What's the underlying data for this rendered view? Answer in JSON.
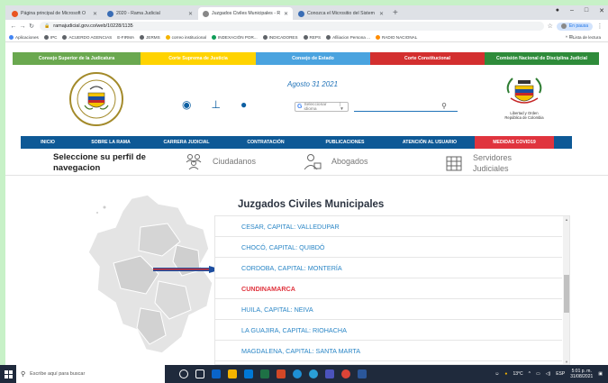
{
  "browser": {
    "tabs": [
      {
        "title": "Página principal de Microsoft O",
        "fav": "#e95420"
      },
      {
        "title": "2020 - Rama Judicial",
        "fav": "#3a6db5"
      },
      {
        "title": "Juzgados Civiles Municipales - R",
        "fav": "#888888"
      },
      {
        "title": "Conozca el Micrositio del Sistem",
        "fav": "#3a6db5"
      }
    ],
    "new_tab": "+",
    "url": "ramajudicial.gov.co/web/10228/1135",
    "profile_label": "En pausa",
    "bookmarks": [
      "Aplicaciones",
      "IPC",
      "ACUERDO AGENCIAS",
      "E-FIRMA",
      "JERMS",
      "correo institucional",
      "INDEXACIÓN POR...",
      "INDICADORES",
      "REPS",
      "Afiliacion Persona ...",
      "RADIO NACIONAL"
    ],
    "reading_list": "Lista de lectura"
  },
  "topnav": [
    {
      "label": "Consejo Superior de la Judicatura",
      "color": "#6aa84f"
    },
    {
      "label": "Corte Suprema de Justicia",
      "color": "#ffd300"
    },
    {
      "label": "Consejo de Estado",
      "color": "#4aa3df"
    },
    {
      "label": "Corte Constitucional",
      "color": "#d32f2f"
    },
    {
      "label": "Comisión Nacional de Disciplina Judicial",
      "color": "#2e8b3a"
    }
  ],
  "header": {
    "date": "Agosto 31 2021",
    "translate_label": "Seleccionar idioma",
    "escudo_line1": "Libertad y Orden",
    "escudo_line2": "República de Colombia"
  },
  "mainnav": [
    "INICIO",
    "SOBRE LA RAMA",
    "CARRERA JUDICIAL",
    "CONTRATACIÓN",
    "PUBLICACIONES",
    "ATENCIÓN AL USUARIO",
    "MEDIDAS COVID19"
  ],
  "profile": {
    "title": "Seleccione su perfil de navegacion",
    "items": [
      "Ciudadanos",
      "Abogados",
      "Servidores Judiciales"
    ]
  },
  "section": {
    "title": "Juzgados Civiles Municipales",
    "items": [
      "CESAR, CAPITAL: VALLEDUPAR",
      "CHOCÓ, CAPITAL: QUIBDÓ",
      "CORDOBA, CAPITAL: MONTERÍA",
      "CUNDINAMARCA",
      "HUILA, CAPITAL: NEIVA",
      "LA GUAJIRA, CAPITAL: RIOHACHA",
      "MAGDALENA, CAPITAL: SANTA MARTA"
    ],
    "selected_index": 3
  },
  "taskbar": {
    "search_placeholder": "Escribe aquí para buscar",
    "weather": "13°C",
    "lang": "ESP",
    "time": "5:01 p. m.",
    "date": "31/08/2021"
  }
}
